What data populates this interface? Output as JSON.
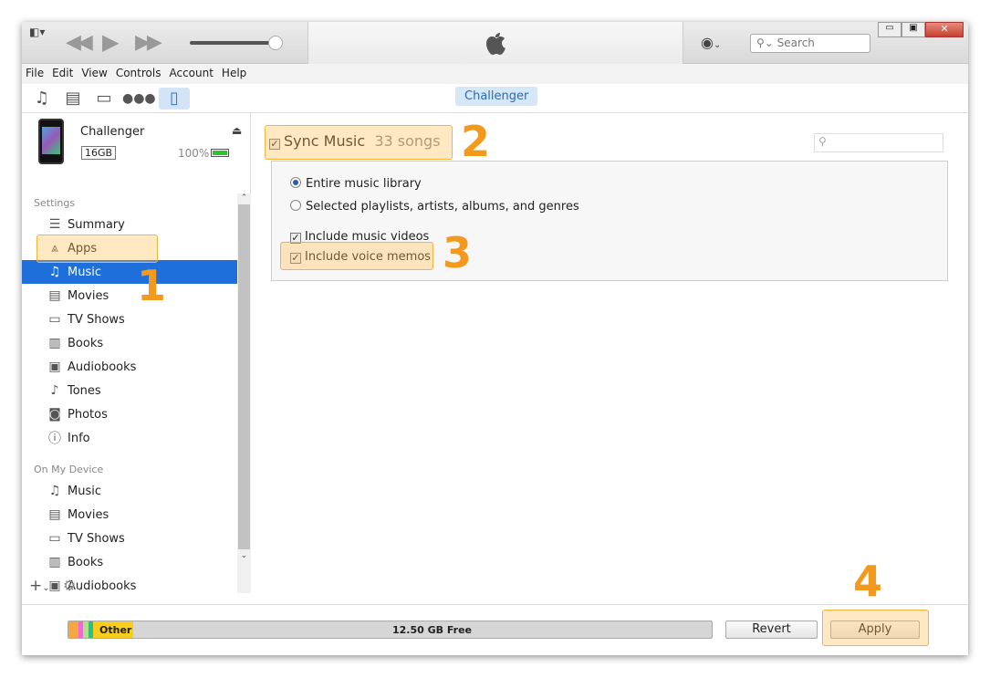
{
  "titlebar": {
    "search_placeholder": "Search",
    "volume_percent": 100
  },
  "menu": [
    "File",
    "Edit",
    "View",
    "Controls",
    "Account",
    "Help"
  ],
  "toolbar": {
    "device_tab": "Challenger"
  },
  "device": {
    "name": "Challenger",
    "capacity": "16GB",
    "battery": "100%"
  },
  "sidebar": {
    "settings_header": "Settings",
    "settings": [
      {
        "label": "Summary",
        "icon": "summary-icon"
      },
      {
        "label": "Apps",
        "icon": "apps-icon"
      },
      {
        "label": "Music",
        "icon": "music-icon",
        "selected": true
      },
      {
        "label": "Movies",
        "icon": "film-icon"
      },
      {
        "label": "TV Shows",
        "icon": "tv-icon"
      },
      {
        "label": "Books",
        "icon": "book-icon"
      },
      {
        "label": "Audiobooks",
        "icon": "audiobook-icon"
      },
      {
        "label": "Tones",
        "icon": "bell-icon"
      },
      {
        "label": "Photos",
        "icon": "camera-icon"
      },
      {
        "label": "Info",
        "icon": "info-icon"
      }
    ],
    "device_header": "On My Device",
    "device_items": [
      {
        "label": "Music"
      },
      {
        "label": "Movies"
      },
      {
        "label": "TV Shows"
      },
      {
        "label": "Books"
      },
      {
        "label": "Audiobooks"
      }
    ]
  },
  "main": {
    "sync_label": "Sync Music",
    "song_count": "33 songs",
    "sync_checked": true,
    "options": {
      "entire": "Entire music library",
      "selected": "Selected playlists, artists, albums, and genres",
      "videos": "Include music videos",
      "memos": "Include voice memos"
    }
  },
  "annotations": [
    "1",
    "2",
    "3",
    "4"
  ],
  "colors": {
    "accent": "#f39a1e",
    "selection": "#1e6fd9"
  },
  "bottom": {
    "other_label": "Other",
    "free_label": "12.50 GB Free",
    "revert": "Revert",
    "apply": "Apply"
  }
}
